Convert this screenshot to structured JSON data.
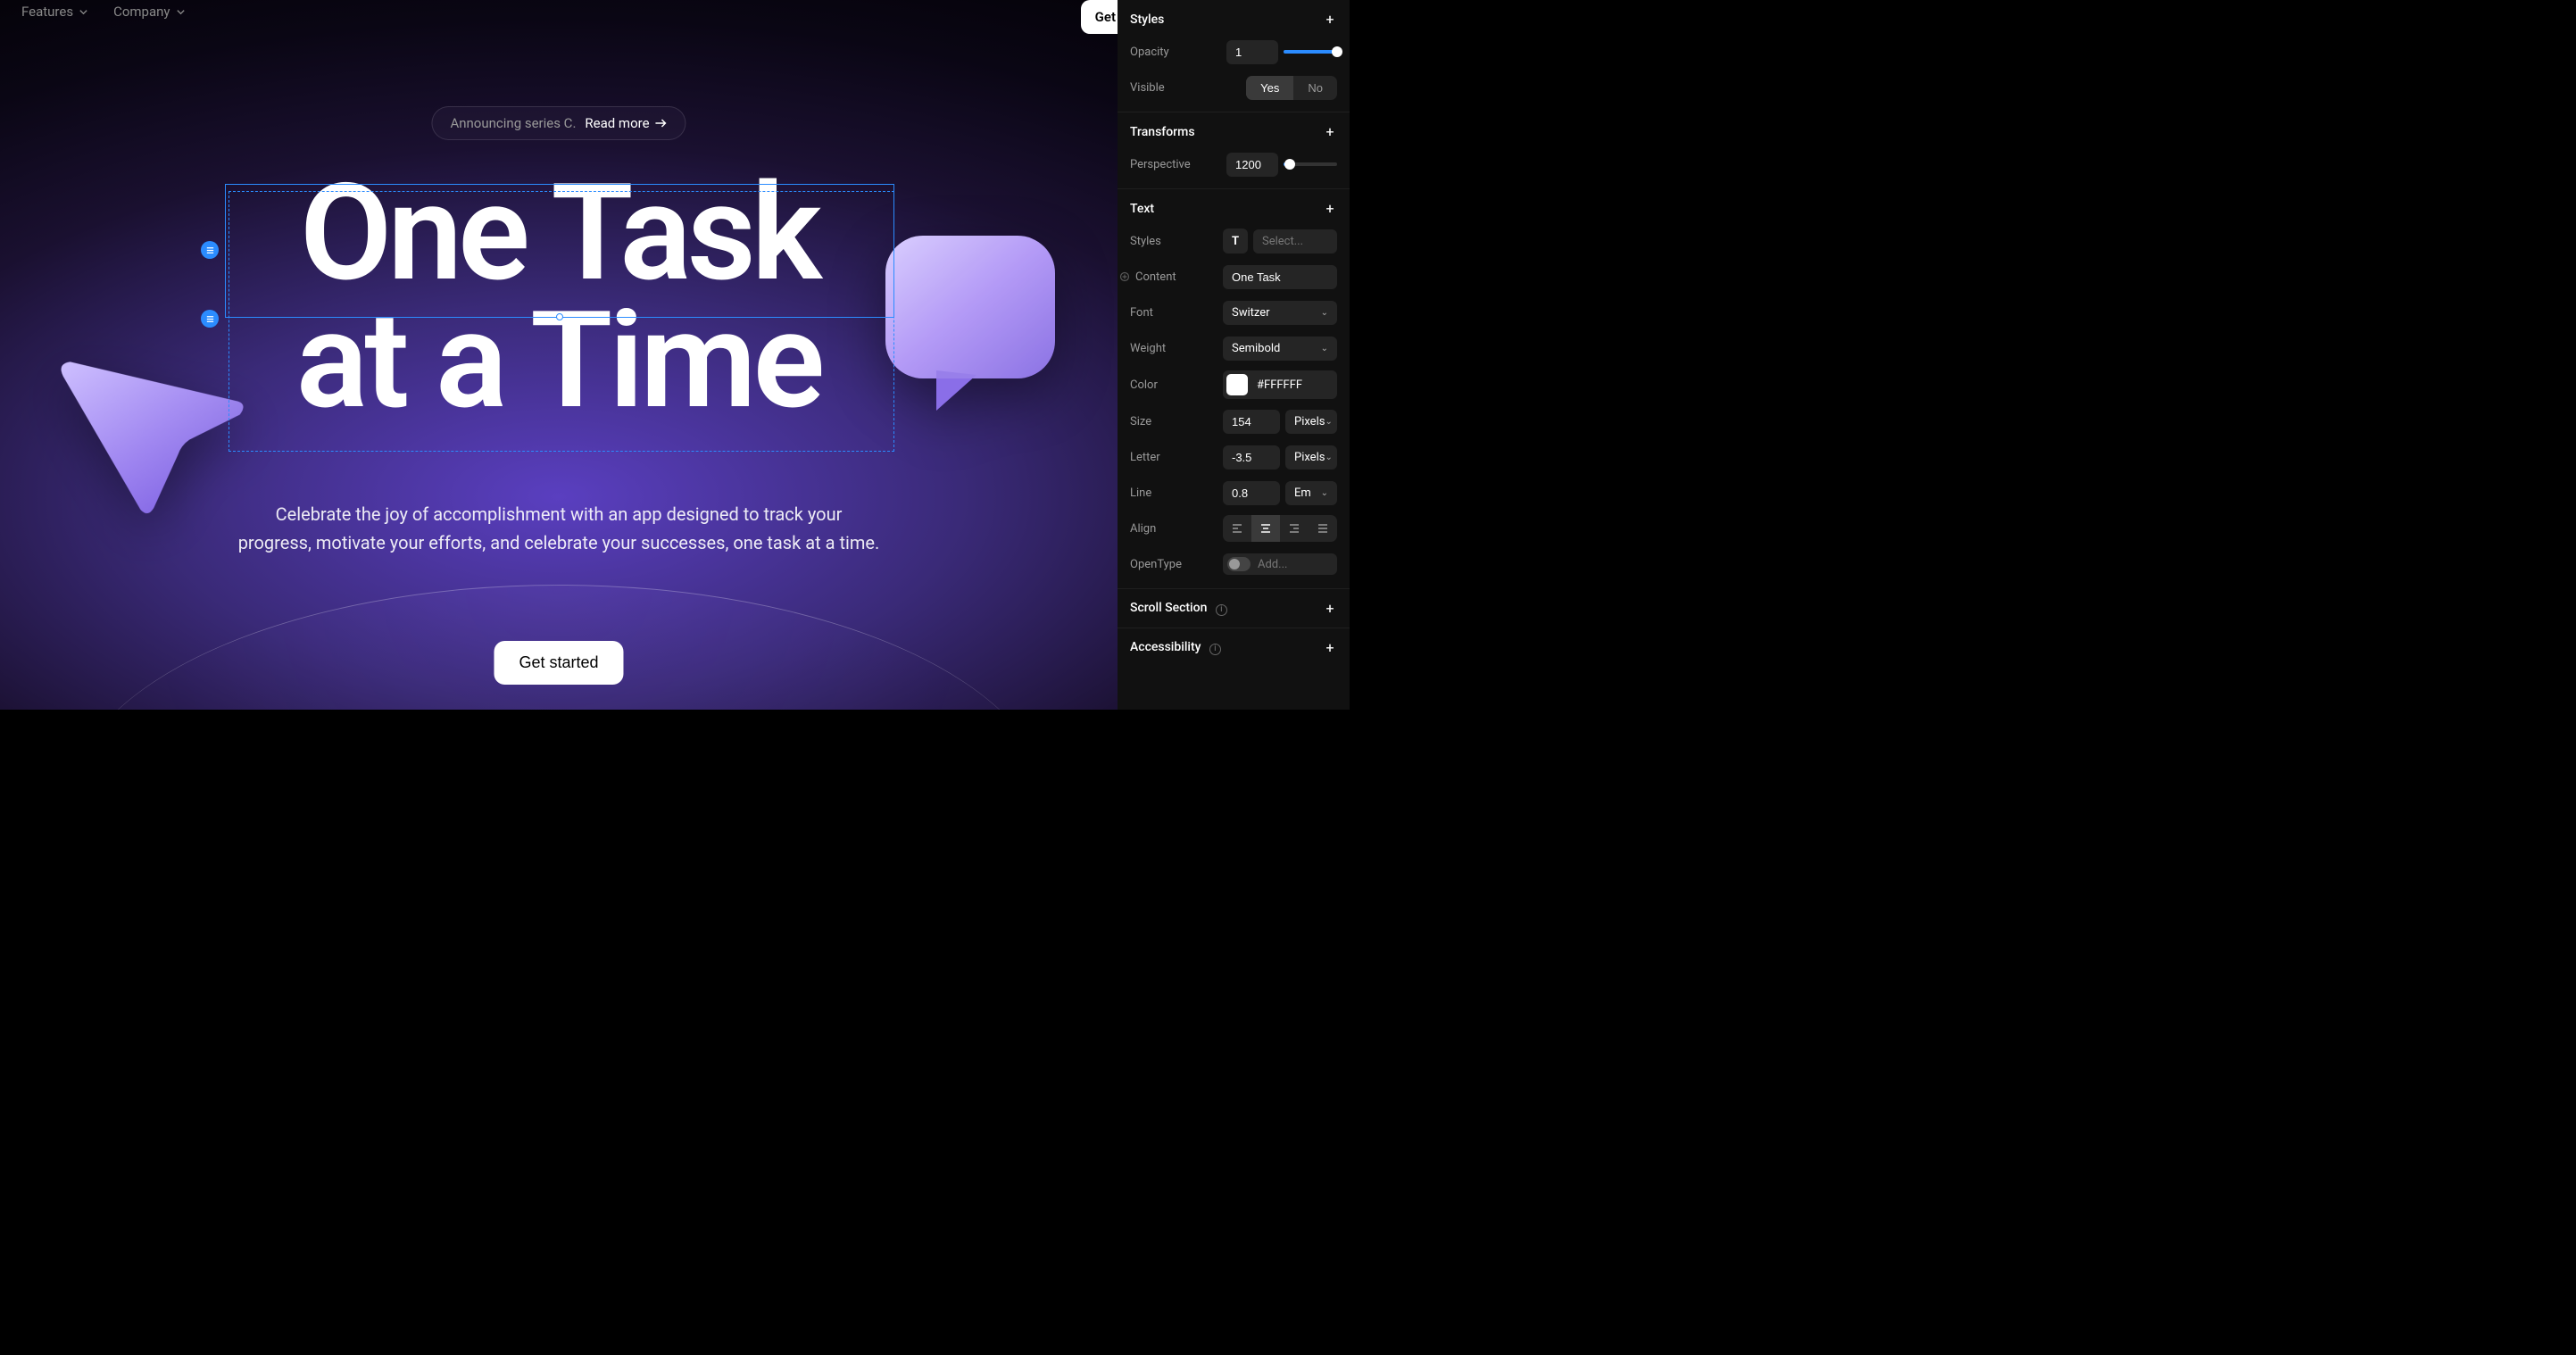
{
  "nav": {
    "features": "Features",
    "company": "Company",
    "get_cut": "Get"
  },
  "hero": {
    "announcement": "Announcing series C.",
    "read_more": "Read more",
    "h1_line1": "One Task",
    "h1_line2": "at a Time",
    "sub": "Celebrate the joy of accomplishment with an app designed to track your progress, motivate your efforts, and celebrate your successes, one task at a time.",
    "cta": "Get started"
  },
  "panel": {
    "styles": {
      "title": "Styles",
      "opacity_label": "Opacity",
      "opacity_value": "1",
      "visible_label": "Visible",
      "visible_yes": "Yes",
      "visible_no": "No"
    },
    "transforms": {
      "title": "Transforms",
      "perspective_label": "Perspective",
      "perspective_value": "1200"
    },
    "text": {
      "title": "Text",
      "styles_label": "Styles",
      "styles_placeholder": "Select...",
      "content_label": "Content",
      "content_value": "One Task",
      "font_label": "Font",
      "font_value": "Switzer",
      "weight_label": "Weight",
      "weight_value": "Semibold",
      "color_label": "Color",
      "color_value": "#FFFFFF",
      "size_label": "Size",
      "size_value": "154",
      "size_unit": "Pixels",
      "letter_label": "Letter",
      "letter_value": "-3.5",
      "letter_unit": "Pixels",
      "line_label": "Line",
      "line_value": "0.8",
      "line_unit": "Em",
      "align_label": "Align",
      "opentype_label": "OpenType",
      "opentype_placeholder": "Add..."
    },
    "scroll": {
      "title": "Scroll Section"
    },
    "accessibility": {
      "title": "Accessibility"
    }
  }
}
